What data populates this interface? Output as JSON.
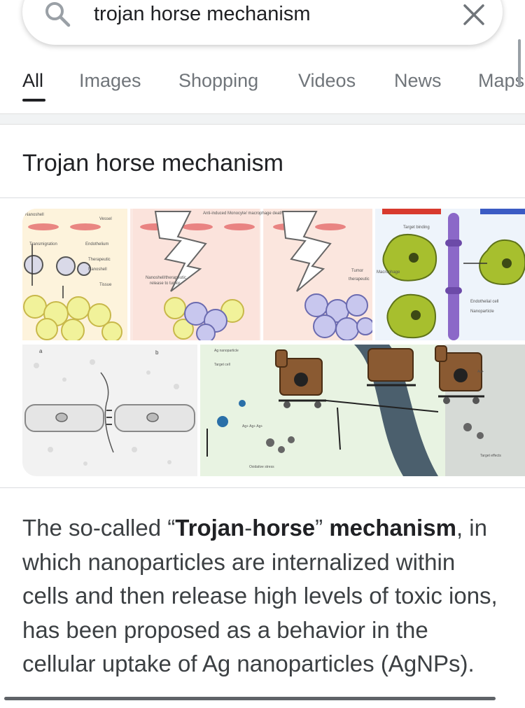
{
  "search": {
    "query": "trojan horse mechanism",
    "search_icon": "search-icon",
    "clear_icon": "close-icon"
  },
  "tabs": [
    {
      "label": "All",
      "active": true
    },
    {
      "label": "Images",
      "active": false
    },
    {
      "label": "Shopping",
      "active": false
    },
    {
      "label": "Videos",
      "active": false
    },
    {
      "label": "News",
      "active": false
    },
    {
      "label": "Maps",
      "active": false
    }
  ],
  "card": {
    "title": "Trojan horse mechanism",
    "images": [
      {
        "caption_top": "Anti-induced Monocyte/ macrophage death"
      },
      {
        "caption_top": ""
      },
      {
        "caption_top": ""
      },
      {
        "caption_top": ""
      }
    ]
  },
  "snippet": {
    "part1": "The so-called “",
    "bold1": "Trojan",
    "part2": "-",
    "bold2": "horse",
    "part3": "” ",
    "bold3": "mechanism",
    "part4": ", in which nanoparticles are internalized within cells and then release high levels of toxic ions, has been proposed as a behavior in the cellular uptake of Ag nanoparticles (AgNPs)."
  },
  "colors": {
    "accent_text": "#202124",
    "muted_text": "#70757a",
    "divider": "#dadce0"
  }
}
